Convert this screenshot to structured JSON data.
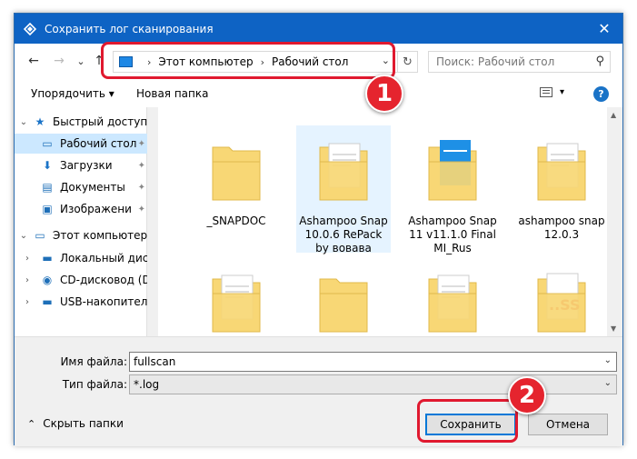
{
  "window": {
    "title": "Сохранить лог сканирования",
    "close_glyph": "✕"
  },
  "navigation": {
    "back_glyph": "←",
    "forward_glyph": "→",
    "recent_glyph": "⌄",
    "up_glyph": "↑",
    "breadcrumb": [
      "Этот компьютер",
      "Рабочий стол"
    ],
    "separator": "›",
    "address_dropdown_glyph": "⌄",
    "refresh_glyph": "↻",
    "search_placeholder": "Поиск: Рабочий стол",
    "search_glyph": "⚲"
  },
  "toolbar": {
    "organize_label": "Упорядочить ▾",
    "new_folder_label": "Новая папка",
    "view_dropdown_glyph": "▾",
    "help_label": "?"
  },
  "sidebar": {
    "items": [
      {
        "label": "Быстрый доступ",
        "icon": "star-icon",
        "glyph": "★",
        "expander": "⌄"
      },
      {
        "label": "Рабочий стол",
        "icon": "desktop-icon",
        "glyph": "▭",
        "pinned": true,
        "selected": true
      },
      {
        "label": "Загрузки",
        "icon": "download-icon",
        "glyph": "⬇",
        "pinned": true
      },
      {
        "label": "Документы",
        "icon": "documents-icon",
        "glyph": "▤",
        "pinned": true
      },
      {
        "label": "Изображени",
        "icon": "images-icon",
        "glyph": "▣",
        "pinned": true
      },
      {
        "label": "Этот компьютер",
        "icon": "computer-icon",
        "glyph": "▭",
        "expander": "⌄"
      },
      {
        "label": "Локальный дис",
        "icon": "disk-icon",
        "glyph": "▬",
        "expander": "›"
      },
      {
        "label": "CD-дисковод (D",
        "icon": "cd-icon",
        "glyph": "◉",
        "expander": "›"
      },
      {
        "label": "USB-накопител",
        "icon": "usb-icon",
        "glyph": "▬",
        "expander": "›"
      }
    ],
    "pin_glyph": "✦"
  },
  "files": [
    {
      "label": "_SNAPDOC",
      "type": "plain"
    },
    {
      "label": "Ashampoo Snap 10.0.6 RePack by вовава",
      "type": "paper",
      "selected": true
    },
    {
      "label": "Ashampoo Snap 11 v11.1.0 Final MI_Rus",
      "type": "blue"
    },
    {
      "label": "ashampoo snap 12.0.3",
      "type": "paper"
    },
    {
      "label": "",
      "type": "paper"
    },
    {
      "label": "",
      "type": "plain"
    },
    {
      "label": "",
      "type": "paper"
    },
    {
      "label": "",
      "type": "red"
    }
  ],
  "form": {
    "filename_label": "Имя файла:",
    "filename_value": "fullscan",
    "filetype_label": "Тип файла:",
    "filetype_value": "*.log",
    "dropdown_glyph": "⌄",
    "hide_folders_label": "Скрыть папки",
    "hide_folders_glyph": "⌃",
    "save_label": "Сохранить",
    "cancel_label": "Отмена"
  },
  "annotations": {
    "badge_1": "1",
    "badge_2": "2",
    "color": "#e0192f"
  },
  "colors": {
    "titlebar": "#0e63c4",
    "selection": "#cce8ff",
    "folder": "#f8d775"
  }
}
